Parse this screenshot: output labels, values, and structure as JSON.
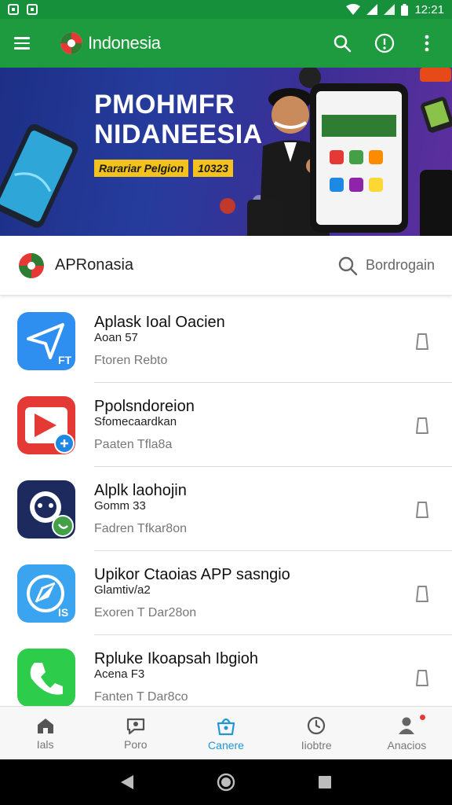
{
  "status_bar": {
    "time": "12:21"
  },
  "app_bar": {
    "title": "Indonesia",
    "icons": [
      "menu-icon",
      "search-icon",
      "info-icon",
      "more-vert-icon"
    ]
  },
  "banner": {
    "line1": "PMOHMFR",
    "line2": "NIDANEESIA",
    "tag_left": "Rarariar Pelgion",
    "tag_right": "10323"
  },
  "search_header": {
    "title": "APRonasia",
    "search_label": "Bordrogain"
  },
  "apps": [
    {
      "name": "Aplask Ioal Oacien",
      "sub": "Aoan 57",
      "meta": "Ftoren Rebto",
      "icon": "paper-plane-icon",
      "color": "#2f8ff0"
    },
    {
      "name": "Ppolsndoreion",
      "sub": "Sfomecaardkan",
      "meta": "Paaten Tfla8a",
      "icon": "play-icon",
      "color": "#e53935"
    },
    {
      "name": "Alplk laohojin",
      "sub": "Gomm 33",
      "meta": "Fadren Tfkar8on",
      "icon": "chat-bubble-icon",
      "color": "#1c2a5e"
    },
    {
      "name": "Upikor Ctaoias APP sasngio",
      "sub": "Glamtiv/a2",
      "meta": "Exoren T Dar28on",
      "icon": "compass-icon",
      "color": "#3aa4f0"
    },
    {
      "name": "Rpluke Ikoapsah Ibgioh",
      "sub": "Acena F3",
      "meta": "Fanten T Dar8co",
      "icon": "phone-icon",
      "color": "#2ecc4b"
    }
  ],
  "bottom_nav": [
    {
      "label": "Ials",
      "icon": "home-icon",
      "active": false
    },
    {
      "label": "Poro",
      "icon": "chat-icon",
      "active": false
    },
    {
      "label": "Canere",
      "icon": "bag-icon",
      "active": true
    },
    {
      "label": "Iiobtre",
      "icon": "clock-icon",
      "active": false
    },
    {
      "label": "Anacios",
      "icon": "person-icon",
      "active": false
    }
  ]
}
